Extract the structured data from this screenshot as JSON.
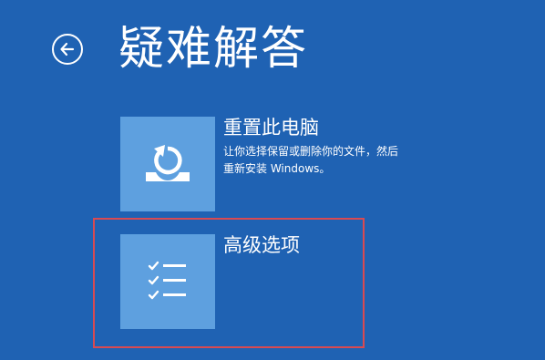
{
  "header": {
    "title": "疑难解答"
  },
  "options": {
    "reset": {
      "title": "重置此电脑",
      "desc_line1": "让你选择保留或删除你的文件，然后",
      "desc_line2": "重新安装 Windows。",
      "icon": "reset-pc-icon"
    },
    "advanced": {
      "title": "高级选项",
      "icon": "checklist-icon"
    }
  },
  "colors": {
    "background": "#1f62b3",
    "tile": "#5ea0df",
    "highlight": "#d84a52"
  }
}
